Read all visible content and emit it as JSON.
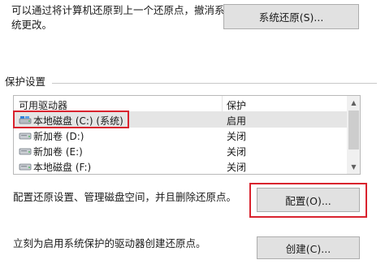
{
  "restore": {
    "description_line1": "可以通过将计算机还原到上一个还原点，撤消系",
    "description_line2": "统更改。",
    "button_label": "系统还原(S)..."
  },
  "protection": {
    "group_title": "保护设置",
    "columns": [
      "可用驱动器",
      "保护"
    ],
    "drives": [
      {
        "name": "本地磁盘 (C:) (系统)",
        "protection": "启用",
        "icon": "system-drive-icon",
        "selected": true
      },
      {
        "name": "新加卷 (D:)",
        "protection": "关闭",
        "icon": "drive-icon"
      },
      {
        "name": "新加卷 (E:)",
        "protection": "关闭",
        "icon": "drive-icon"
      },
      {
        "name": "本地磁盘 (F:)",
        "protection": "关闭",
        "icon": "drive-icon"
      }
    ],
    "configure_text": "配置还原设置、管理磁盘空间，并且删除还原点。",
    "configure_button": "配置(O)...",
    "create_text": "立刻为启用系统保护的驱动器创建还原点。",
    "create_button": "创建(C)..."
  },
  "colors": {
    "highlight": "#d9232e",
    "button_bg": "#e1e1e1",
    "selected_row": "#e5e5e5"
  }
}
